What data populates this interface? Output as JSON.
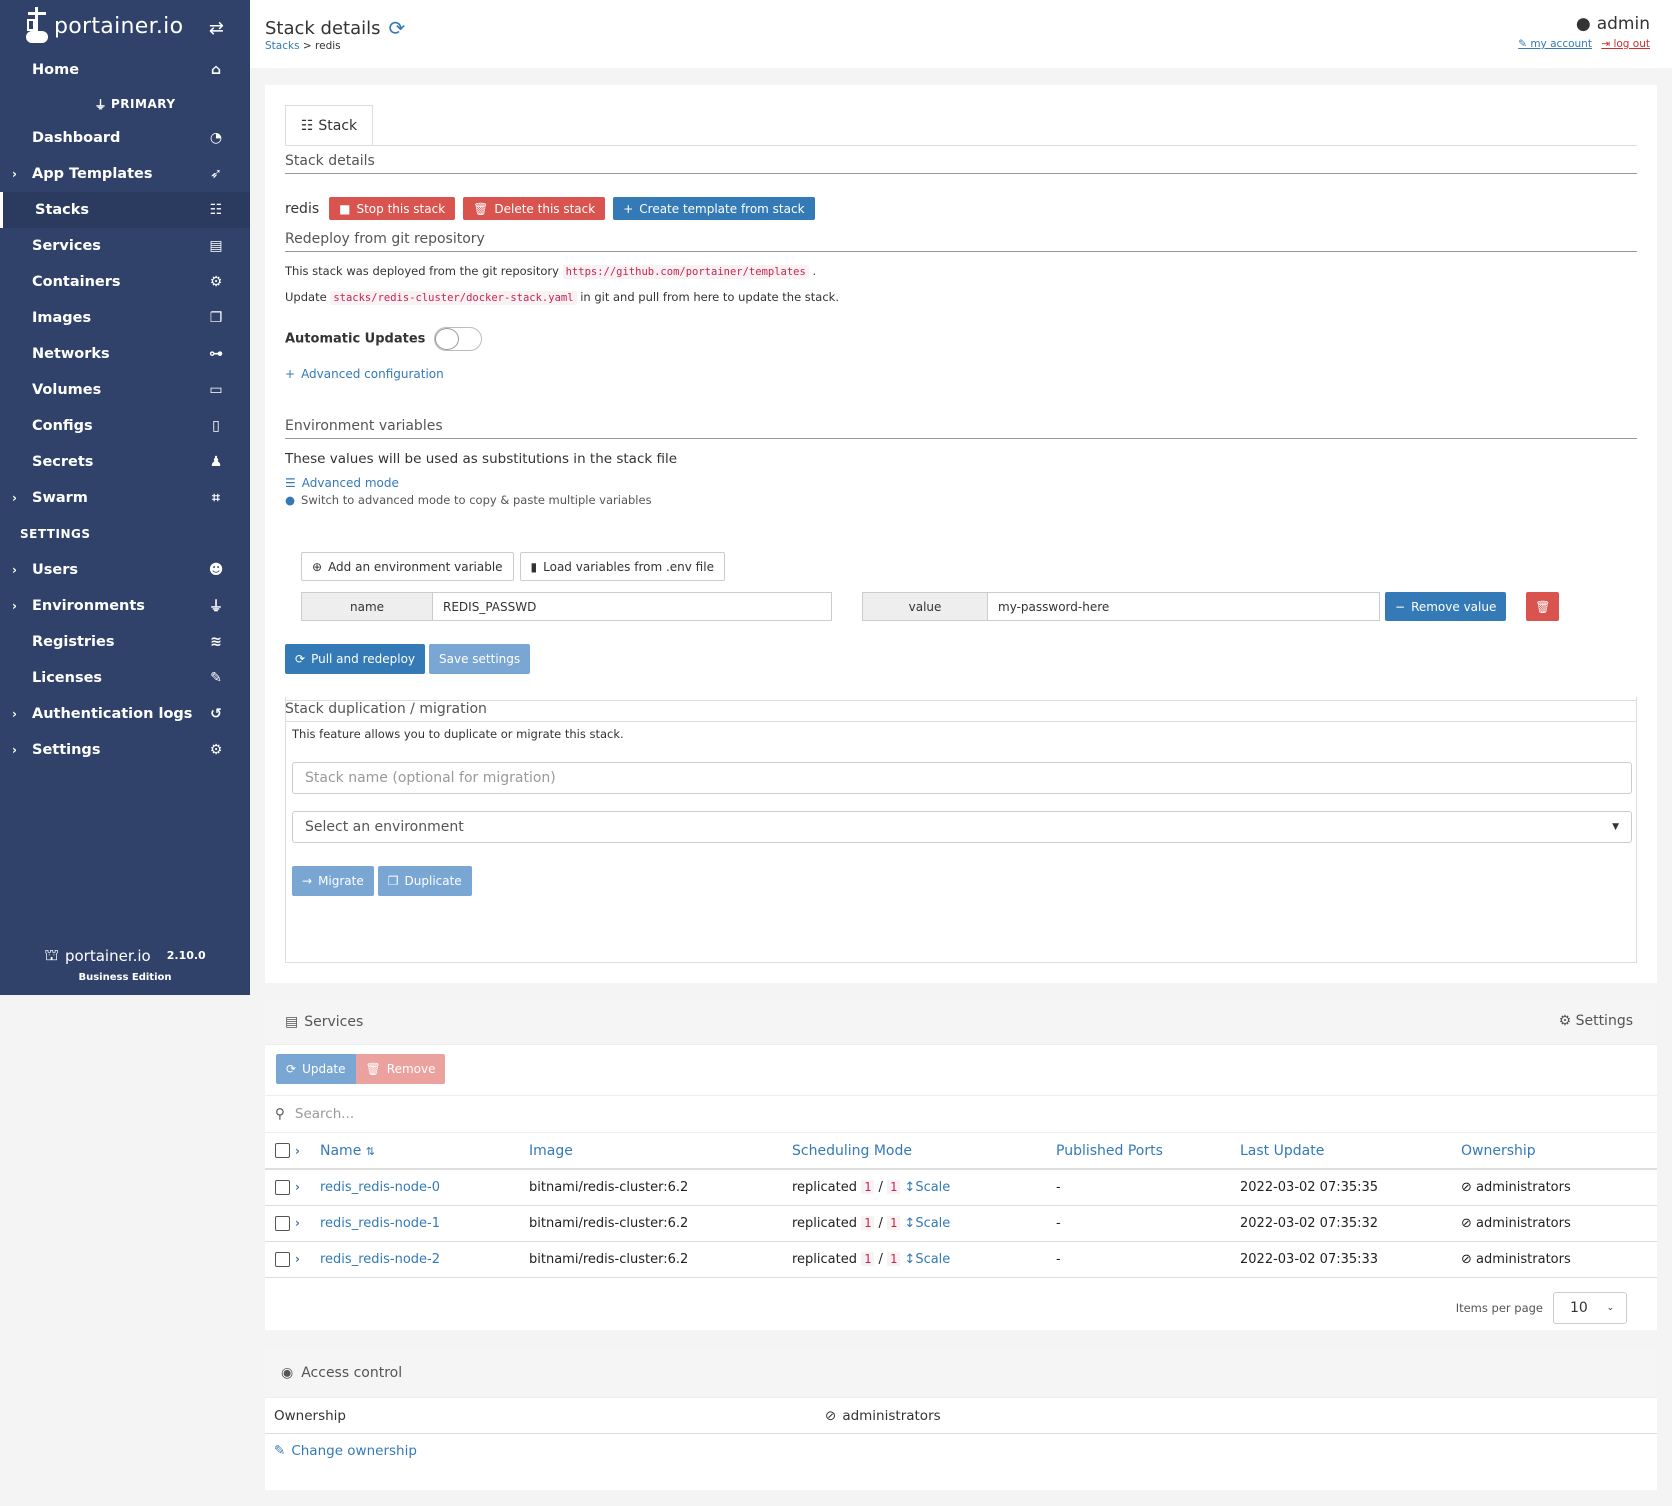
{
  "sidebar": {
    "logo": "portainer.io",
    "env_label": "PRIMARY",
    "settings_header": "SETTINGS",
    "items_top": [
      {
        "label": "Home",
        "icon": "home-icon",
        "glyph": "⌂"
      }
    ],
    "items_env": [
      {
        "label": "Dashboard",
        "icon": "tachometer-icon",
        "glyph": "◔",
        "chevron": false
      },
      {
        "label": "App Templates",
        "icon": "rocket-icon",
        "glyph": "➶",
        "chevron": true
      },
      {
        "label": "Stacks",
        "icon": "th-list-icon",
        "glyph": "☷",
        "chevron": false,
        "active": true
      },
      {
        "label": "Services",
        "icon": "list-alt-icon",
        "glyph": "▤",
        "chevron": false
      },
      {
        "label": "Containers",
        "icon": "cubes-icon",
        "glyph": "⚙",
        "chevron": false
      },
      {
        "label": "Images",
        "icon": "clone-icon",
        "glyph": "❐",
        "chevron": false
      },
      {
        "label": "Networks",
        "icon": "sitemap-icon",
        "glyph": "⊶",
        "chevron": false
      },
      {
        "label": "Volumes",
        "icon": "hdd-icon",
        "glyph": "▭",
        "chevron": false
      },
      {
        "label": "Configs",
        "icon": "file-code-icon",
        "glyph": "▯",
        "chevron": false
      },
      {
        "label": "Secrets",
        "icon": "user-secret-icon",
        "glyph": "♟",
        "chevron": false
      },
      {
        "label": "Swarm",
        "icon": "object-group-icon",
        "glyph": "⌗",
        "chevron": true
      }
    ],
    "items_settings": [
      {
        "label": "Users",
        "icon": "users-icon",
        "glyph": "☻",
        "chevron": true
      },
      {
        "label": "Environments",
        "icon": "plug-icon",
        "glyph": "⏚",
        "chevron": true
      },
      {
        "label": "Registries",
        "icon": "database-icon",
        "glyph": "≋",
        "chevron": false
      },
      {
        "label": "Licenses",
        "icon": "file-signature-icon",
        "glyph": "✎",
        "chevron": false
      },
      {
        "label": "Authentication logs",
        "icon": "history-icon",
        "glyph": "↺",
        "chevron": true
      },
      {
        "label": "Settings",
        "icon": "cogs-icon",
        "glyph": "⚙",
        "chevron": true
      }
    ],
    "footer_brand": "portainer.io",
    "footer_version": "2.10.0",
    "footer_edition": "Business Edition"
  },
  "header": {
    "title": "Stack details",
    "breadcrumb_parent": "Stacks",
    "breadcrumb_sep": ">",
    "breadcrumb_current": "redis",
    "user": "admin",
    "my_account": "my account",
    "log_out": "log out"
  },
  "stack": {
    "tab_label": "Stack",
    "details_title": "Stack details",
    "name": "redis",
    "stop_btn": "Stop this stack",
    "delete_btn": "Delete this stack",
    "template_btn": "Create template from stack",
    "git_title": "Redeploy from git repository",
    "git_text_1": "This stack was deployed from the git repository",
    "git_repo": "https://github.com/portainer/templates",
    "git_text_1_end": ".",
    "git_text_2a": "Update",
    "git_file": "stacks/redis-cluster/docker-stack.yaml",
    "git_text_2b": "in git and pull from here to update the stack.",
    "auto_updates_label": "Automatic Updates",
    "advanced_config": "Advanced configuration",
    "env_title": "Environment variables",
    "env_desc": "These values will be used as substitutions in the stack file",
    "advanced_mode": "Advanced mode",
    "advanced_mode_hint": "Switch to advanced mode to copy & paste multiple variables",
    "add_env_btn": "Add an environment variable",
    "load_env_btn": "Load variables from .env file",
    "env_name_label": "name",
    "env_name_value": "REDIS_PASSWD",
    "env_value_label": "value",
    "env_value_value": "my-password-here",
    "remove_value_btn": "Remove value",
    "pull_redeploy_btn": "Pull and redeploy",
    "save_settings_btn": "Save settings",
    "dup_title": "Stack duplication / migration",
    "dup_desc": "This feature allows you to duplicate or migrate this stack.",
    "dup_name_placeholder": "Stack name (optional for migration)",
    "dup_env_select": "Select an environment",
    "migrate_btn": "Migrate",
    "duplicate_btn": "Duplicate"
  },
  "services": {
    "title": "Services",
    "settings": "Settings",
    "update_btn": "Update",
    "remove_btn": "Remove",
    "search_placeholder": "Search...",
    "columns": [
      "Name",
      "Image",
      "Scheduling Mode",
      "Published Ports",
      "Last Update",
      "Ownership"
    ],
    "rows": [
      {
        "name": "redis_redis-node-0",
        "image": "bitnami/redis-cluster:6.2",
        "mode": "replicated",
        "running": "1",
        "desired": "1",
        "scale": "Scale",
        "ports": "-",
        "updated": "2022-03-02 07:35:35",
        "owner": "administrators"
      },
      {
        "name": "redis_redis-node-1",
        "image": "bitnami/redis-cluster:6.2",
        "mode": "replicated",
        "running": "1",
        "desired": "1",
        "scale": "Scale",
        "ports": "-",
        "updated": "2022-03-02 07:35:32",
        "owner": "administrators"
      },
      {
        "name": "redis_redis-node-2",
        "image": "bitnami/redis-cluster:6.2",
        "mode": "replicated",
        "running": "1",
        "desired": "1",
        "scale": "Scale",
        "ports": "-",
        "updated": "2022-03-02 07:35:33",
        "owner": "administrators"
      }
    ],
    "items_per_page_label": "Items per page",
    "items_per_page": "10"
  },
  "access": {
    "title": "Access control",
    "ownership_label": "Ownership",
    "ownership_value": "administrators",
    "change_link": "Change ownership"
  },
  "colors": {
    "sidebar_bg": "#30426a",
    "primary": "#337ab7",
    "danger": "#d9534f"
  }
}
